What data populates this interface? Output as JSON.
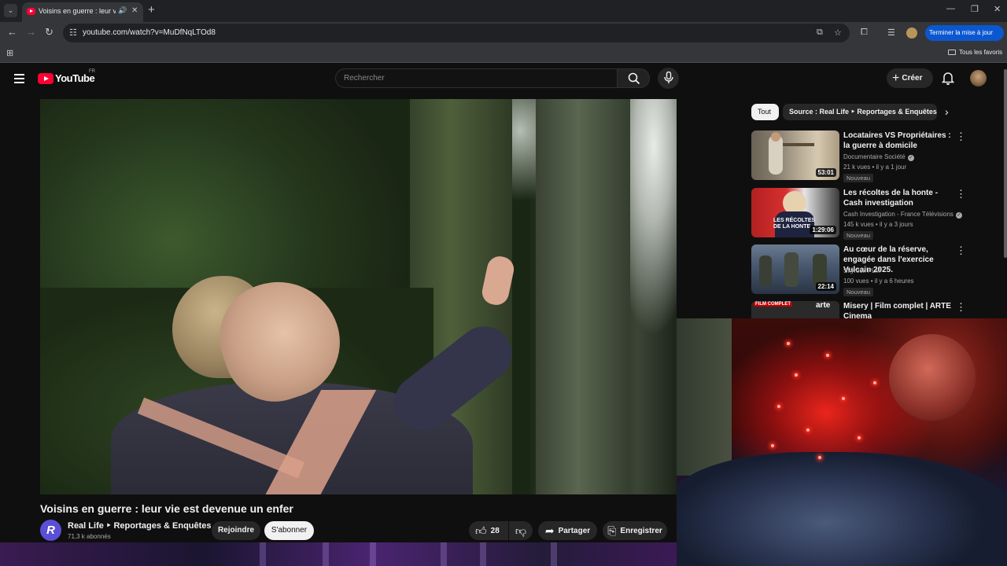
{
  "browser": {
    "tab_title": "Voisins en guerre : leur vie est devenue un enfer - YouTube",
    "url": "youtube.com/watch?v=MuDfNqLTOd8",
    "update_button": "Terminer la mise à jour",
    "all_bookmarks": "Tous les favoris"
  },
  "youtube": {
    "logo": "YouTube",
    "country": "FR",
    "search_placeholder": "Rechercher",
    "create_label": "Créer"
  },
  "video": {
    "title": "Voisins en guerre : leur vie est devenue un enfer",
    "channel_initial": "R",
    "channel_name": "Real Life ‣ Reportages & Enquêtes",
    "subscribers": "71,3 k abonnés",
    "join_label": "Rejoindre",
    "subscribe_label": "S'abonner",
    "likes": "28",
    "share_label": "Partager",
    "save_label": "Enregistrer"
  },
  "filters": {
    "chips": [
      "Tout",
      "Source : Real Life ‣ Reportages & Enquêtes"
    ]
  },
  "recommendations": [
    {
      "title": "Locataires VS Propriétaires : la guerre à domicile",
      "channel": "Documentaire Société",
      "verified": true,
      "meta": "21 k vues • il y a 1 jour",
      "badge": "Nouveau",
      "duration": "53:01"
    },
    {
      "title": "Les récoltes de la honte - Cash investigation",
      "channel": "Cash Investigation - France Télévisions",
      "verified": true,
      "meta": "145 k vues • il y a 3 jours",
      "badge": "Nouveau",
      "duration": "1:29:06",
      "thumb_text": "LES RÉCOLTES DE LA HONTE"
    },
    {
      "title": "Au cœur de la réserve, engagée dans l'exercice Vulcain 2025.",
      "channel": "Skyrock PLM",
      "verified": false,
      "meta": "100 vues • il y a 6 heures",
      "badge": "Nouveau",
      "duration": "22:14"
    },
    {
      "title": "Misery | Film complet | ARTE Cinema",
      "channel": "",
      "verified": false,
      "meta": "",
      "badge": "",
      "duration": "",
      "thumb_text": "FILM COMPLET",
      "thumb_brand": "arte"
    }
  ]
}
